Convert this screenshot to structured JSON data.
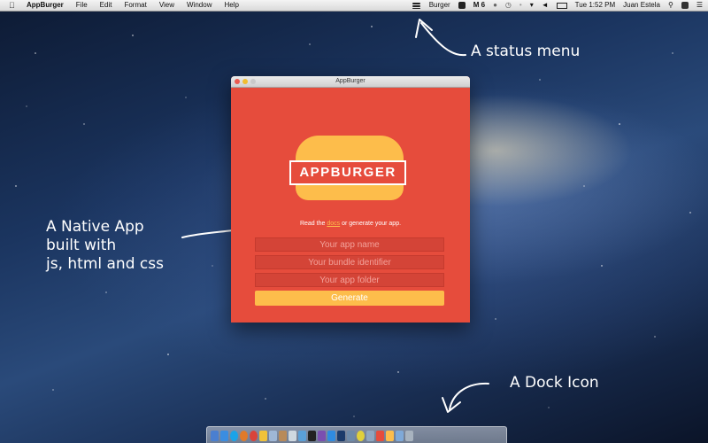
{
  "menubar": {
    "app_name": "AppBurger",
    "menus": [
      "File",
      "Edit",
      "Format",
      "View",
      "Window",
      "Help"
    ],
    "status_item_label": "Burger",
    "status_badge": "M 6",
    "clock": "Tue 1:52 PM",
    "user": "Juan Estela"
  },
  "window": {
    "title": "AppBurger",
    "logo_text": "APPBURGER",
    "read_prefix": "Read the",
    "docs_link": "docs",
    "read_suffix": "or generate your app.",
    "fields": {
      "app_name_placeholder": "Your app name",
      "bundle_placeholder": "Your bundle identifier",
      "folder_placeholder": "Your app folder"
    },
    "generate_label": "Generate"
  },
  "annotations": {
    "status_menu": "A status menu",
    "native_app_lines": [
      "A Native App",
      "built with",
      "js, html and css"
    ],
    "dock_icon": "A Dock Icon"
  },
  "colors": {
    "app_red": "#e64c3c",
    "bun_yellow": "#fdbd4b"
  },
  "icons": {
    "menubar_right": [
      "burger-icon",
      "skype-icon",
      "notification-icon",
      "clock-icon",
      "bluetooth-icon",
      "wifi-icon",
      "volume-icon",
      "battery-icon",
      "search-icon",
      "user-icon",
      "list-icon"
    ],
    "dock": [
      "finder-icon",
      "safari-icon",
      "skype-icon",
      "firefox-icon",
      "chrome-icon",
      "adium-icon",
      "mail-icon",
      "address-book-icon",
      "preview-icon",
      "itunes-icon",
      "terminal-icon",
      "textmate-icon",
      "app-store-icon",
      "photoshop-icon",
      "keynote-icon",
      "sublime-icon",
      "folder-icon",
      "tv-icon",
      "appburger-icon",
      "downloads-icon",
      "trash-icon"
    ]
  }
}
